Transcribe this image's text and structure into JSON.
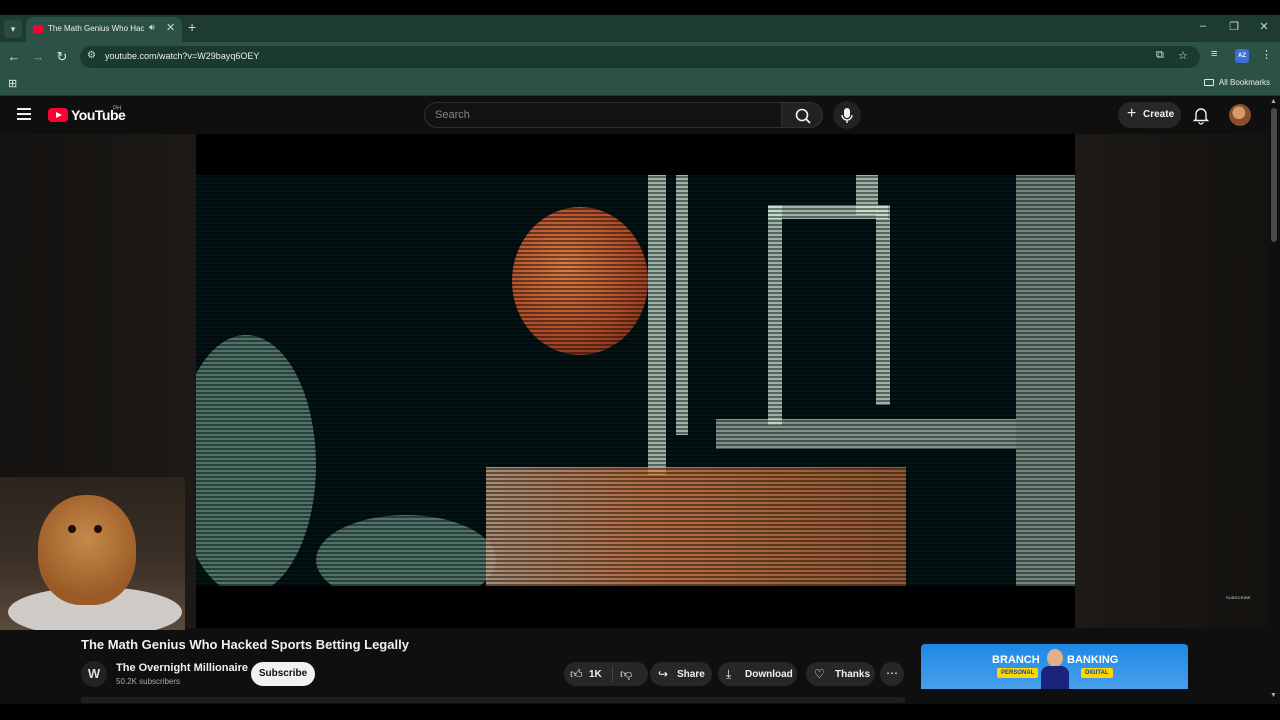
{
  "browser": {
    "tab_title": "The Math Genius Who Hacked Sports Betting Legally",
    "url": "youtube.com/watch?v=W29bayq6OEY",
    "all_bookmarks_label": "All Bookmarks"
  },
  "masthead": {
    "logo_text": "YouTube",
    "region": "PH",
    "search_placeholder": "Search",
    "create_label": "Create"
  },
  "video": {
    "title": "The Math Genius Who Hacked Sports Betting Legally",
    "channel": {
      "name": "The Overnight Millionaire",
      "subscribers": "50.2K subscribers",
      "avatar_letter": "W"
    },
    "subscribe_label": "Subscribe",
    "likes": "1K",
    "share_label": "Share",
    "download_label": "Download",
    "thanks_label": "Thanks",
    "watermark": "SUBSCRIBE"
  },
  "ad": {
    "word_left": "BRANCH",
    "word_right": "BANKING",
    "tag_left": "PERSONAL",
    "tag_right": "DIGITAL"
  },
  "colors": {
    "yt_red": "#ff0033",
    "chrome_frame": "#2c5247",
    "background": "#0f0f0f"
  }
}
